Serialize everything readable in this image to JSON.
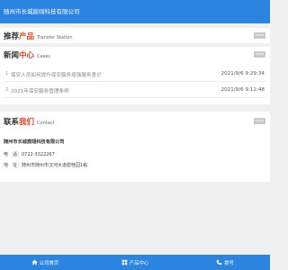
{
  "header": {
    "title": "随州市长城宸翊科技有限公司"
  },
  "recommend": {
    "title_main": "推荐",
    "title_accent": "产品",
    "subtitle": "Transfer Station",
    "more": "more"
  },
  "news": {
    "title_main": "新闻",
    "title_accent": "中心",
    "subtitle": "Cases",
    "more": "more",
    "items": [
      {
        "num": "1",
        "title": "保安人员如何提升保安服务增强服务意识",
        "date": "2021/9/6 9:29:34"
      },
      {
        "num": "2",
        "title": "2021年保安服务管理条例",
        "date": "2021/9/6 9:12:48"
      }
    ]
  },
  "contact": {
    "title_main": "联系",
    "title_accent": "我们",
    "subtitle": "Contact",
    "more": "more",
    "company": "随州市长城宸翊科技有限公司",
    "phone": "电　话：0722-3322267",
    "address": "地　址：随州市随州市汉河大道碧桂园1栋"
  },
  "footer": {
    "items": [
      {
        "label": "公司首页",
        "icon": "home-icon"
      },
      {
        "label": "产品中心",
        "icon": "grid-icon"
      },
      {
        "label": "拨号",
        "icon": "phone-icon"
      }
    ]
  },
  "colors": {
    "brand": "#2a84e0",
    "accent": "#e8401c"
  }
}
